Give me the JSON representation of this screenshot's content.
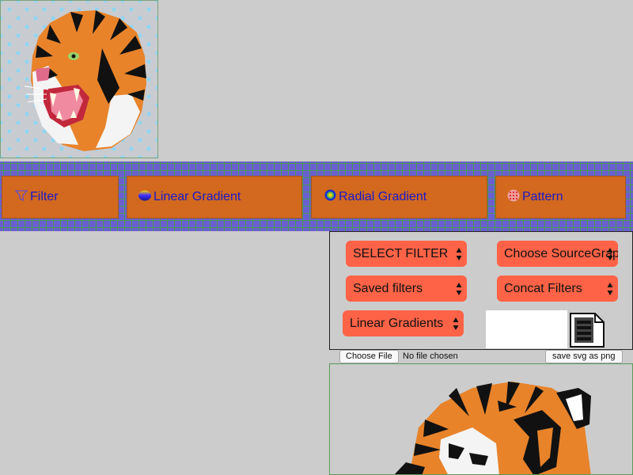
{
  "preview": {
    "image": "tiger-head-with-pattern-background"
  },
  "tabs": [
    {
      "label": "Filter",
      "icon": "filter-funnel-icon"
    },
    {
      "label": "Linear Gradient",
      "icon": "linear-gradient-icon"
    },
    {
      "label": "Radial Gradient",
      "icon": "radial-gradient-icon"
    },
    {
      "label": "Pattern",
      "icon": "pattern-icon"
    }
  ],
  "controls": {
    "select_filter": "SELECT FILTER",
    "choose_source": "Choose SourceGraphic",
    "saved_filters": "Saved filters",
    "concat_filters": "Concat Filters",
    "linear_gradients": "Linear Gradients"
  },
  "file": {
    "choose_label": "Choose File",
    "status": "No file chosen",
    "save_label": "save svg as png"
  },
  "colors": {
    "tab_bg": "#d2691e",
    "tab_text": "#1a1acb",
    "select_bg": "#ff6347",
    "tabbar_bg": "#6a5fd0",
    "page_bg": "#cccccc"
  }
}
